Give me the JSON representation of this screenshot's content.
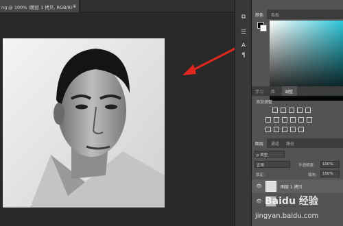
{
  "document": {
    "tab_title": "ng @ 100% (图层 1 拷贝, RGB/8) *",
    "close_glyph": "×"
  },
  "right_panel": {
    "color_tabs": [
      "颜色",
      "色板"
    ],
    "adjust_tabs": [
      "学习",
      "库",
      "调整"
    ],
    "adjust_heading": "添加调整",
    "layer_tabs": [
      "图层",
      "通道",
      "路径"
    ],
    "filter_kind": "ρ 类型",
    "blend_mode": "正常",
    "opacity_label": "不透明度:",
    "opacity_value": "100%",
    "lock_label": "锁定:",
    "fill_label": "填充:",
    "fill_value": "100%",
    "layers": [
      {
        "name": "图层 1 拷贝",
        "selected": true
      },
      {
        "name": "",
        "selected": false
      }
    ]
  },
  "tools": [
    "arrange-icon",
    "layers-panel-icon",
    "type-tool-icon",
    "paragraph-icon"
  ],
  "watermark": {
    "brand": "Baidu 经验",
    "url": "jingyan.baidu.com"
  },
  "colors": {
    "arrow": "#e0261f",
    "canvas_bg": "#282828",
    "panel_bg": "#535353"
  }
}
